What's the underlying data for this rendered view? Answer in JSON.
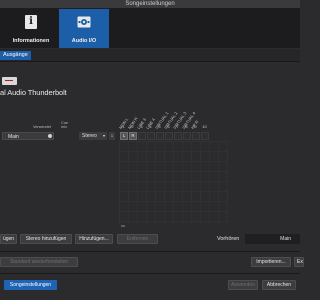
{
  "window": {
    "title": "Songeinstellungen"
  },
  "tabs": [
    {
      "label": "Informationen",
      "icon": "info-icon"
    },
    {
      "label": "Audio I/O",
      "icon": "audio-io-icon"
    }
  ],
  "subtabs": {
    "active": "Ausgänge"
  },
  "device": {
    "name": "al Audio Thunderbolt"
  },
  "headers": {
    "verwendet": "Verwendet",
    "cue_mix_1": "Cue",
    "cue_mix_2": "mix"
  },
  "row": {
    "name": "Main",
    "format": "Stereo",
    "index": "1",
    "left": "L",
    "right": "R"
  },
  "columns": {
    "labels": [
      "MON L",
      "MON R",
      "LINE 3",
      "LINE 4",
      "VIRTUAL 1",
      "VIRTUAL 2",
      "VIRTUAL 3",
      "VIRTUAL 4",
      "HP R"
    ],
    "numbers": [
      "1",
      "2",
      "3",
      "4",
      "5",
      "6",
      "7",
      "8",
      "9",
      "10"
    ]
  },
  "buttons": {
    "add_mono_partial": "ügen",
    "add_stereo": "Stereo hinzufügen",
    "add_more": "Hinzufügen...",
    "remove": "Entfernen",
    "reset_default": "Standard wiederherstellen",
    "import": "Importieren...",
    "export_partial": "Ex",
    "song_settings": "Songeinstellungen",
    "apply": "Anwenden",
    "cancel": "Abbrechen"
  },
  "preview": {
    "label": "Vorhören",
    "value": "Main"
  }
}
